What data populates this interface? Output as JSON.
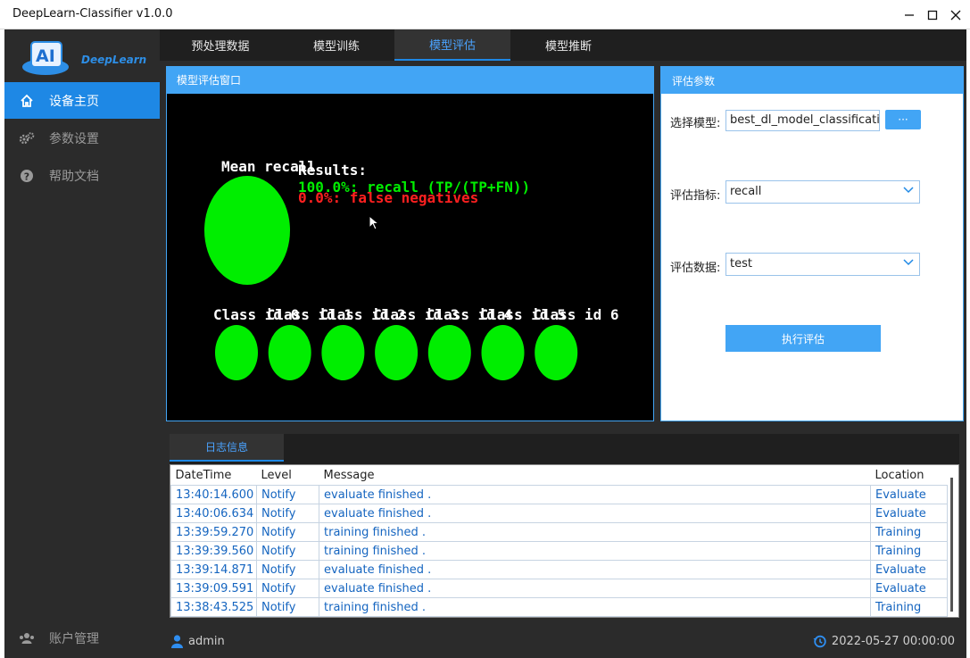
{
  "window": {
    "title": "DeepLearn-Classifier v1.0.0",
    "controls": [
      "minimize-icon",
      "maximize-icon",
      "close-icon"
    ]
  },
  "sidebar": {
    "logo_text": "DeepLearn",
    "logo_badge": "AI",
    "items": [
      {
        "label": "设备主页",
        "icon": "home-icon",
        "active": true
      },
      {
        "label": "参数设置",
        "icon": "gears-icon",
        "active": false
      },
      {
        "label": "帮助文档",
        "icon": "help-icon",
        "active": false
      }
    ],
    "footer": {
      "label": "账户管理",
      "icon": "users-icon"
    }
  },
  "tabs": [
    {
      "label": "预处理数据",
      "active": false
    },
    {
      "label": "模型训练",
      "active": false
    },
    {
      "label": "模型评估",
      "active": true
    },
    {
      "label": "模型推断",
      "active": false
    }
  ],
  "eval_window": {
    "title": "模型评估窗口",
    "mean_label": "Mean recall",
    "results_title": "Results:",
    "result_line1": "100.0%: recall (TP/(TP+FN))",
    "result_line2": "0.0%: false negatives",
    "class_labels": [
      "Class id 0",
      "Class id 1",
      "Class id 2",
      "Class id 3",
      "Class id 4",
      "Class id 5",
      "Class id 6"
    ],
    "good_color": "#00ee00",
    "bad_color": "#ff0000"
  },
  "params": {
    "title": "评估参数",
    "model_label": "选择模型:",
    "model_value": "best_dl_model_classification",
    "browse_label": "···",
    "metric_label": "评估指标:",
    "metric_value": "recall",
    "data_label": "评估数据:",
    "data_value": "test",
    "run_label": "执行评估"
  },
  "log": {
    "tab_label": "日志信息",
    "columns": [
      "DateTime",
      "Level",
      "Message",
      "Location"
    ],
    "rows": [
      [
        "13:40:14.600",
        "Notify",
        "evaluate finished .",
        "Evaluate"
      ],
      [
        "13:40:06.634",
        "Notify",
        "evaluate finished .",
        "Evaluate"
      ],
      [
        "13:39:59.270",
        "Notify",
        "training finished .",
        "Training"
      ],
      [
        "13:39:39.560",
        "Notify",
        "training finished .",
        "Training"
      ],
      [
        "13:39:14.871",
        "Notify",
        "evaluate finished .",
        "Evaluate"
      ],
      [
        "13:39:09.591",
        "Notify",
        "evaluate finished .",
        "Evaluate"
      ],
      [
        "13:38:43.525",
        "Notify",
        "training finished .",
        "Training"
      ]
    ]
  },
  "status": {
    "user": "admin",
    "datetime": "2022-05-27 00:00:00"
  },
  "theme": {
    "accent": "#1e88e5",
    "panel_blue": "#42a5f5",
    "dark_bg": "#2b2b2b"
  }
}
